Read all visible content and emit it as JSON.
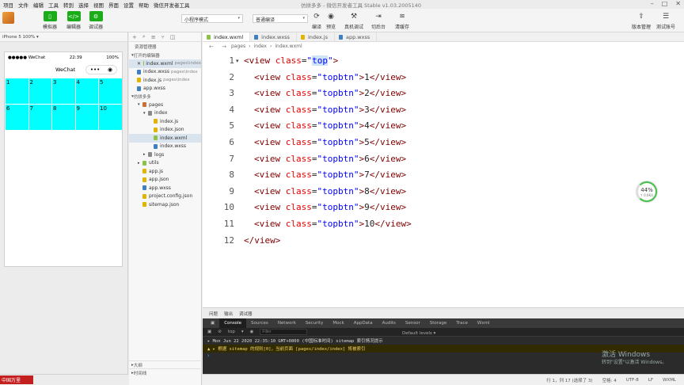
{
  "menu": [
    "项目",
    "文件",
    "编辑",
    "工具",
    "转到",
    "选择",
    "视图",
    "界面",
    "设置",
    "帮助",
    "微信开发者工具"
  ],
  "window_title": "仿拼多多 - 微信开发者工具 Stable v1.03.2005140",
  "toolbar": {
    "simulator": "模拟器",
    "editor": "编辑器",
    "debugger": "调试器",
    "mode_select": "小程序模式",
    "compile_select": "普通编译",
    "compile": "编译",
    "preview": "预览",
    "real_debug": "真机调试",
    "switch_bg": "切后台",
    "clear_cache": "清缓存",
    "version_mgmt": "版本管理",
    "test_account": "测试账号"
  },
  "simulator": {
    "device": "iPhone 5 100% ▾",
    "status_carrier": "●●●●● WeChat",
    "status_time": "22:39",
    "status_battery": "100%",
    "nav_title": "WeChat",
    "cells": [
      "1",
      "2",
      "3",
      "4",
      "5",
      "6",
      "7",
      "8",
      "9",
      "10"
    ]
  },
  "explorer": {
    "title": "资源管理器",
    "open_editors": "打开的编辑器",
    "open_files": [
      {
        "name": "index.wxml",
        "path": "pages\\index",
        "color": "#8bc34a",
        "active": true
      },
      {
        "name": "index.wxss",
        "path": "pages\\index",
        "color": "#3f7fbf",
        "active": false
      },
      {
        "name": "index.js",
        "path": "pages\\index",
        "color": "#e0b400",
        "active": false
      },
      {
        "name": "app.wxss",
        "path": "",
        "color": "#3f7fbf",
        "active": false
      }
    ],
    "project": "仿拼多多",
    "tree": [
      {
        "name": "pages",
        "depth": 1,
        "color": "#c96f3a",
        "arrow": "▾"
      },
      {
        "name": "index",
        "depth": 2,
        "color": "#8a8a8a",
        "arrow": "▾"
      },
      {
        "name": "index.js",
        "depth": 3,
        "color": "#e0b400",
        "arrow": ""
      },
      {
        "name": "index.json",
        "depth": 3,
        "color": "#e0b400",
        "arrow": ""
      },
      {
        "name": "index.wxml",
        "depth": 3,
        "color": "#8bc34a",
        "arrow": "",
        "active": true
      },
      {
        "name": "index.wxss",
        "depth": 3,
        "color": "#3f7fbf",
        "arrow": ""
      },
      {
        "name": "logs",
        "depth": 2,
        "color": "#8a8a8a",
        "arrow": "▸"
      },
      {
        "name": "utils",
        "depth": 1,
        "color": "#8bc34a",
        "arrow": "▸"
      },
      {
        "name": "app.js",
        "depth": 1,
        "color": "#e0b400",
        "arrow": ""
      },
      {
        "name": "app.json",
        "depth": 1,
        "color": "#e0b400",
        "arrow": ""
      },
      {
        "name": "app.wxss",
        "depth": 1,
        "color": "#3f7fbf",
        "arrow": ""
      },
      {
        "name": "project.config.json",
        "depth": 1,
        "color": "#e0b400",
        "arrow": ""
      },
      {
        "name": "sitemap.json",
        "depth": 1,
        "color": "#e0b400",
        "arrow": ""
      }
    ],
    "outline": "大纲",
    "timeline": "时间线"
  },
  "editor": {
    "tabs": [
      {
        "name": "index.wxml",
        "color": "#8bc34a",
        "active": true
      },
      {
        "name": "index.wxss",
        "color": "#3f7fbf",
        "active": false
      },
      {
        "name": "index.js",
        "color": "#e0b400",
        "active": false
      },
      {
        "name": "app.wxss",
        "color": "#3f7fbf",
        "active": false
      }
    ],
    "breadcrumb": [
      "pages",
      "index",
      "index.wxml"
    ],
    "lines": [
      {
        "n": "1",
        "indent": 0,
        "tag": "view",
        "attr": "class",
        "val": "top",
        "text": "",
        "close": false,
        "open_only": true
      },
      {
        "n": "2",
        "indent": 1,
        "tag": "view",
        "attr": "class",
        "val": "topbtn",
        "text": "1",
        "close": true
      },
      {
        "n": "3",
        "indent": 1,
        "tag": "view",
        "attr": "class",
        "val": "topbtn",
        "text": "2",
        "close": true
      },
      {
        "n": "4",
        "indent": 1,
        "tag": "view",
        "attr": "class",
        "val": "topbtn",
        "text": "3",
        "close": true
      },
      {
        "n": "5",
        "indent": 1,
        "tag": "view",
        "attr": "class",
        "val": "topbtn",
        "text": "4",
        "close": true
      },
      {
        "n": "6",
        "indent": 1,
        "tag": "view",
        "attr": "class",
        "val": "topbtn",
        "text": "5",
        "close": true
      },
      {
        "n": "7",
        "indent": 1,
        "tag": "view",
        "attr": "class",
        "val": "topbtn",
        "text": "6",
        "close": true
      },
      {
        "n": "8",
        "indent": 1,
        "tag": "view",
        "attr": "class",
        "val": "topbtn",
        "text": "7",
        "close": true
      },
      {
        "n": "9",
        "indent": 1,
        "tag": "view",
        "attr": "class",
        "val": "topbtn",
        "text": "8",
        "close": true
      },
      {
        "n": "10",
        "indent": 1,
        "tag": "view",
        "attr": "class",
        "val": "topbtn",
        "text": "9",
        "close": true
      },
      {
        "n": "11",
        "indent": 1,
        "tag": "view",
        "attr": "class",
        "val": "topbtn",
        "text": "10",
        "close": true
      },
      {
        "n": "12",
        "indent": 0,
        "closing_only": true,
        "tag": "view"
      }
    ],
    "perf_percent": "44%",
    "perf_speed": "↑ 0.6K/s"
  },
  "panel": {
    "top_tabs": [
      "问题",
      "输出",
      "调试器"
    ],
    "devtools_tabs": [
      "Console",
      "Sources",
      "Network",
      "Security",
      "Mock",
      "AppData",
      "Audits",
      "Sensor",
      "Storage",
      "Trace",
      "Wxml"
    ],
    "context": "top",
    "filter_placeholder": "Filter",
    "levels": "Default levels ▾",
    "log_info": "▸ Mon Jun 22 2020 22:35:10 GMT+0800 (中国标准时间) sitemap 索引情况提示",
    "log_warn": "▲ ▸ 根据 sitemap 的规则[0]，当前页面 [pages/index/index] 将被索引",
    "prompt": "›"
  },
  "statusbar": [
    "行 1，列 17 (选择了 3)",
    "空格: 4",
    "UTF-8",
    "LF",
    "WXML"
  ],
  "watermark": {
    "line1": "激活 Windows",
    "line2": "转到\"设置\"以激活 Windows。"
  },
  "logo_text": "中国万里"
}
